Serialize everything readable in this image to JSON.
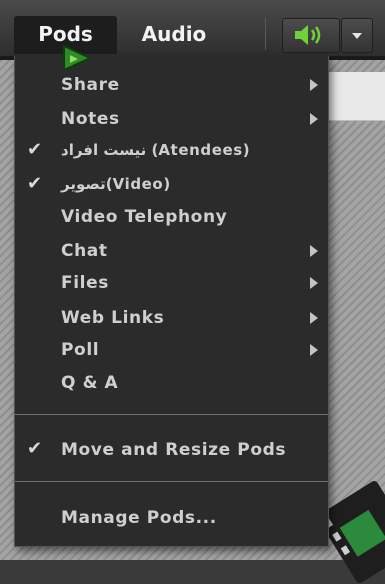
{
  "menubar": {
    "pods_label": "Pods",
    "audio_label": "Audio",
    "speaker_icon": "speaker-volume-icon",
    "dropdown_icon": "chevron-down-icon",
    "accent_color": "#6fd23c"
  },
  "pods_menu": {
    "items": [
      {
        "label": "Share",
        "checked": false,
        "submenu": true
      },
      {
        "label": "Notes",
        "checked": false,
        "submenu": true
      },
      {
        "label": "نیست افراد (Atendees)",
        "checked": true,
        "submenu": false
      },
      {
        "label": "تصویر(Video)",
        "checked": true,
        "submenu": false
      },
      {
        "label": "Video Telephony",
        "checked": false,
        "submenu": false
      },
      {
        "label": "Chat",
        "checked": false,
        "submenu": true
      },
      {
        "label": "Files",
        "checked": false,
        "submenu": true
      },
      {
        "label": "Web Links",
        "checked": false,
        "submenu": true
      },
      {
        "label": "Poll",
        "checked": false,
        "submenu": true
      },
      {
        "label": "Q & A",
        "checked": false,
        "submenu": false
      },
      {
        "label": "Move and Resize Pods",
        "checked": true,
        "submenu": false
      },
      {
        "label": "Manage Pods...",
        "checked": false,
        "submenu": false
      }
    ],
    "check_glyph": "✔"
  }
}
